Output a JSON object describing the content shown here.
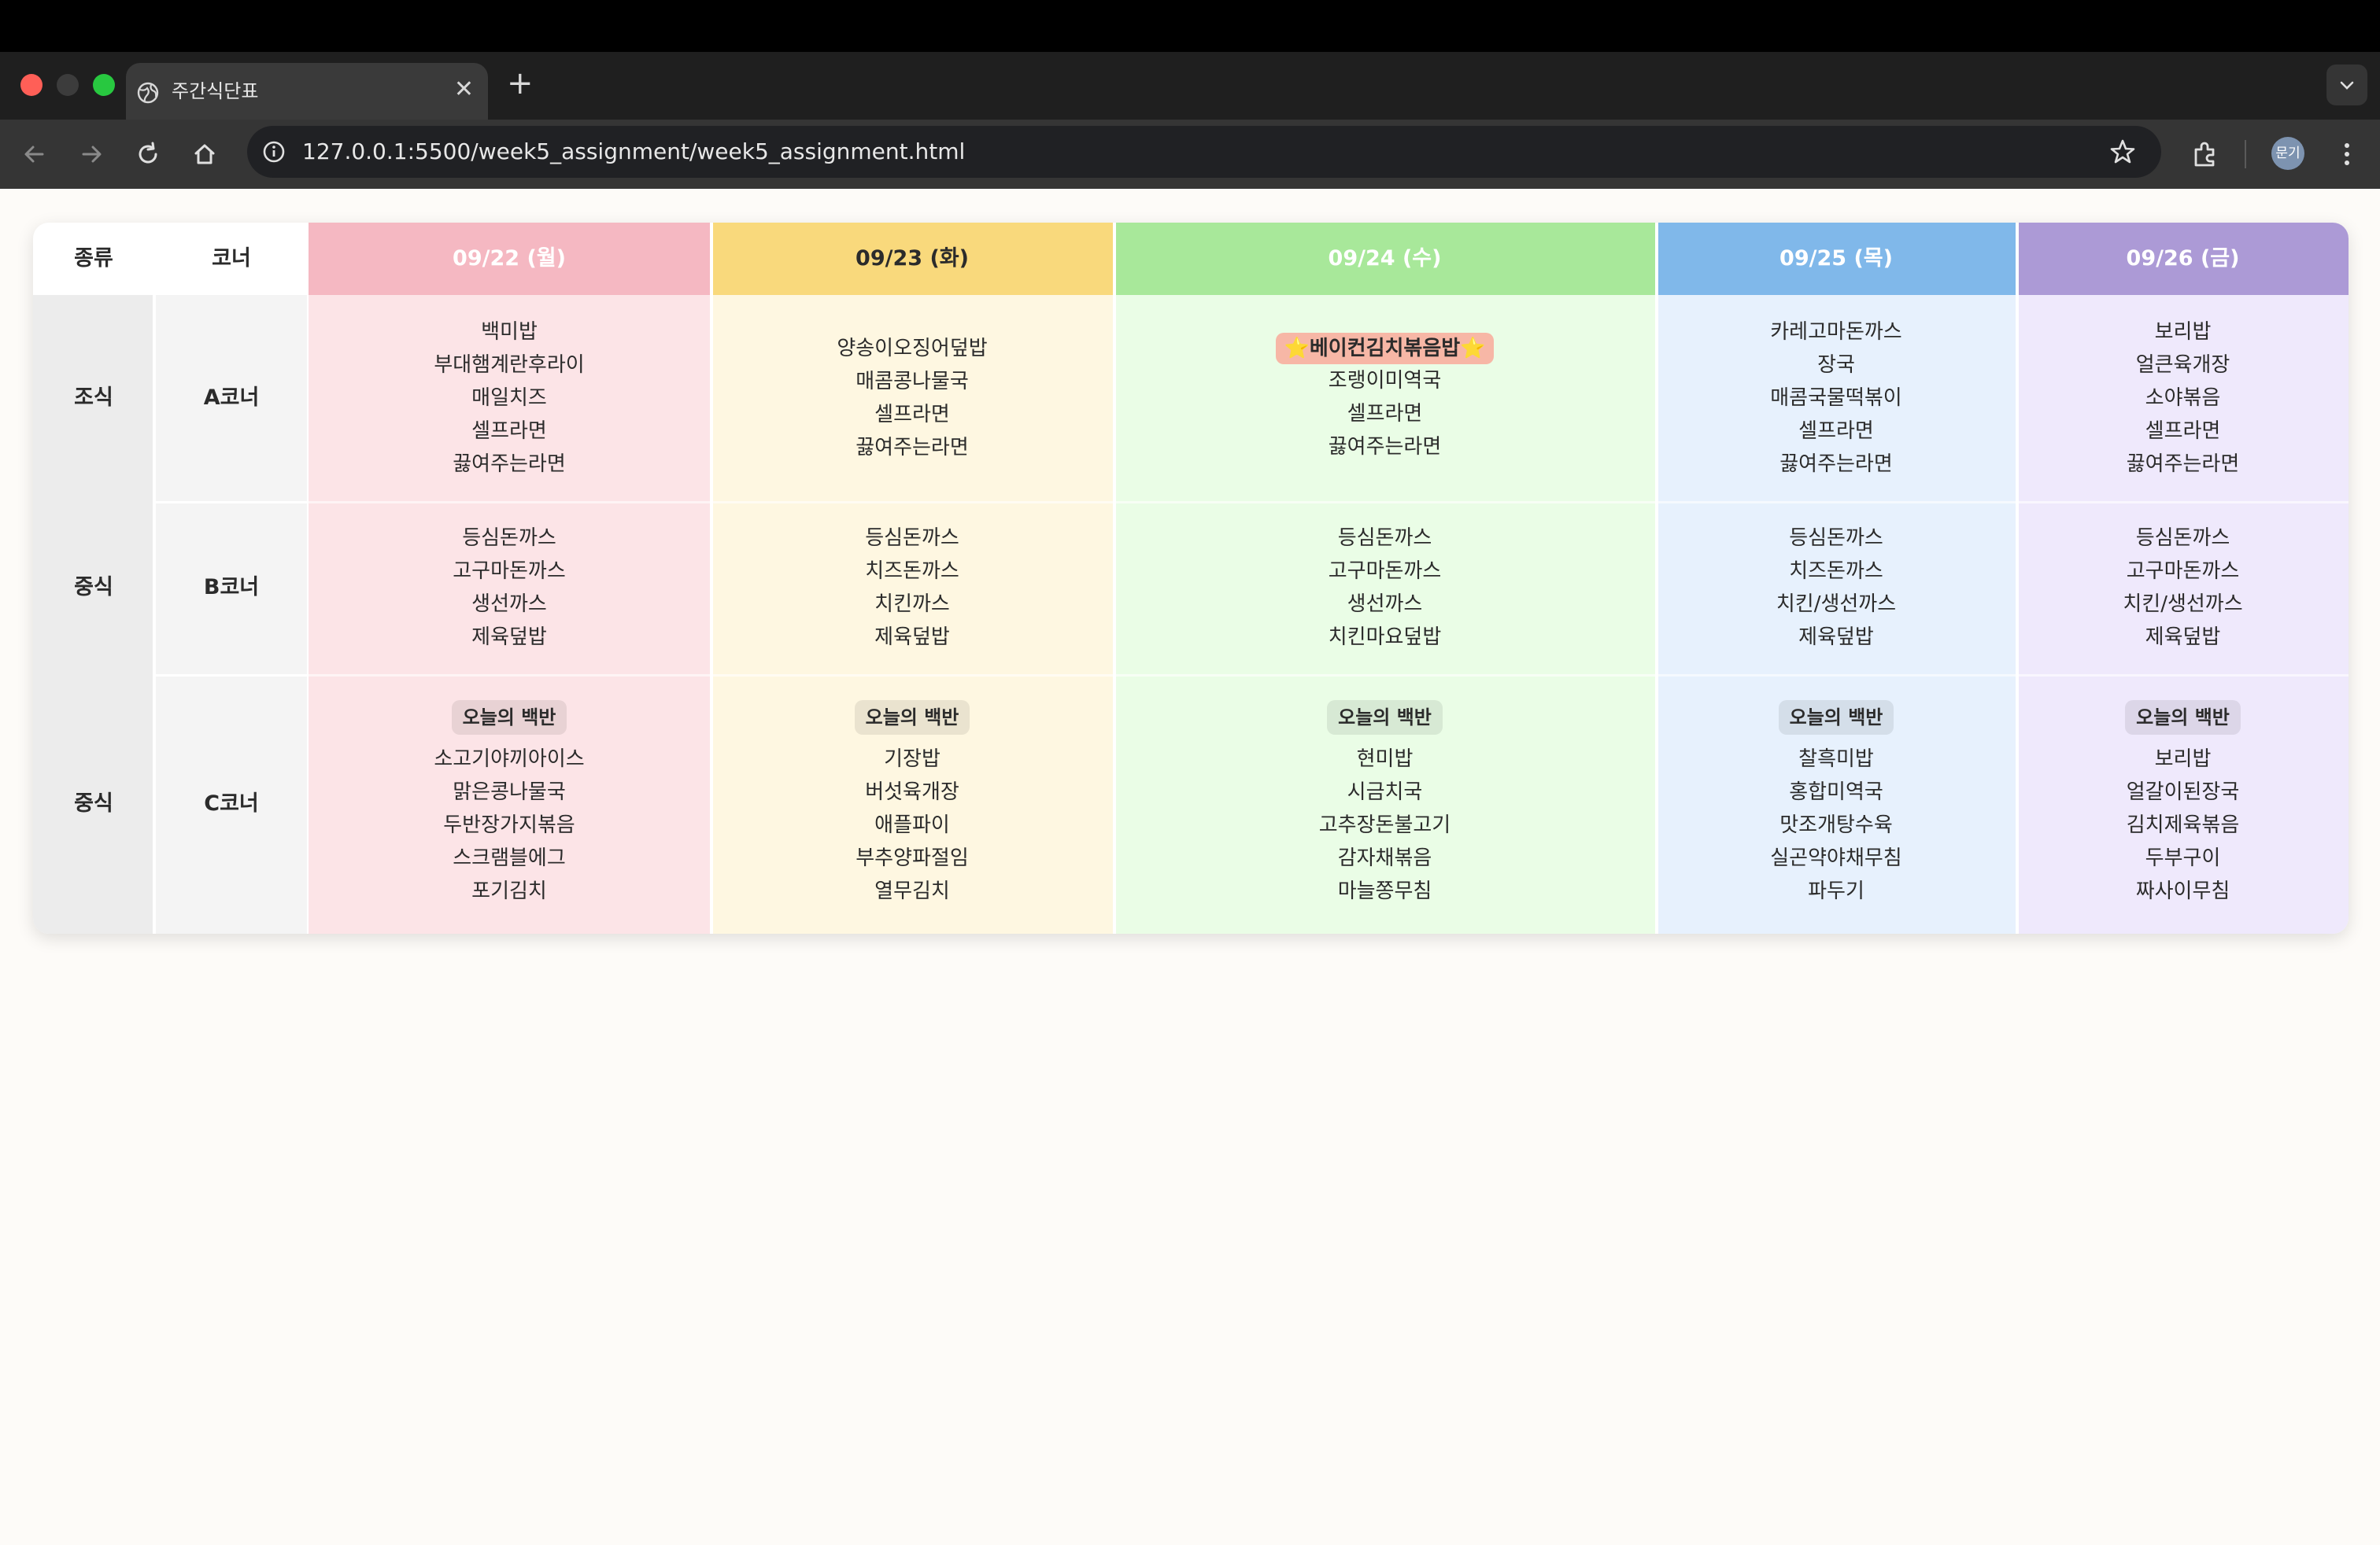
{
  "browser": {
    "tab_title": "주간식단표",
    "url": "127.0.0.1:5500/week5_assignment/week5_assignment.html",
    "profile_label": "문기"
  },
  "table": {
    "header": {
      "type": "종류",
      "corner": "코너"
    },
    "days": [
      {
        "label": "09/22 (월)",
        "header_color": "#f5b8c2",
        "body_color": "#fce4e7",
        "header_text_color": "#ffffff"
      },
      {
        "label": "09/23 (화)",
        "header_color": "#f9d97c",
        "body_color": "#fef7e1",
        "header_text_color": "#2b2b2b"
      },
      {
        "label": "09/24 (수)",
        "header_color": "#a8e89a",
        "body_color": "#eafde6",
        "header_text_color": "#ffffff"
      },
      {
        "label": "09/25 (목)",
        "header_color": "#80b8ea",
        "body_color": "#e7f1fd",
        "header_text_color": "#ffffff"
      },
      {
        "label": "09/26 (금)",
        "header_color": "#ac9ad6",
        "body_color": "#efe9fc",
        "header_text_color": "#ffffff"
      }
    ],
    "rows": [
      {
        "type": "조식",
        "corner": "A코너",
        "menus": [
          [
            "백미밥",
            "부대햄계란후라이",
            "매일치즈",
            "셀프라면",
            "끓여주는라면"
          ],
          [
            "양송이오징어덮밥",
            "매콤콩나물국",
            "셀프라면",
            "끓여주는라면"
          ],
          [
            "조랭이미역국",
            "셀프라면",
            "끓여주는라면"
          ],
          [
            "카레고마돈까스",
            "장국",
            "매콤국물떡볶이",
            "셀프라면",
            "끓여주는라면"
          ],
          [
            "보리밥",
            "얼큰육개장",
            "소야볶음",
            "셀프라면",
            "끓여주는라면"
          ]
        ],
        "special": {
          "day_index": 2,
          "text": "베이컨김치볶음밥",
          "star": "⭐"
        }
      },
      {
        "type": "중식",
        "corner": "B코너",
        "menus": [
          [
            "등심돈까스",
            "고구마돈까스",
            "생선까스",
            "제육덮밥"
          ],
          [
            "등심돈까스",
            "치즈돈까스",
            "치킨까스",
            "제육덮밥"
          ],
          [
            "등심돈까스",
            "고구마돈까스",
            "생선까스",
            "치킨마요덮밥"
          ],
          [
            "등심돈까스",
            "치즈돈까스",
            "치킨/생선까스",
            "제육덮밥"
          ],
          [
            "등심돈까스",
            "고구마돈까스",
            "치킨/생선까스",
            "제육덮밥"
          ]
        ]
      },
      {
        "type": "중식",
        "corner": "C코너",
        "badge": "오늘의 백반",
        "menus": [
          [
            "소고기야끼아이스",
            "맑은콩나물국",
            "두반장가지볶음",
            "스크램블에그",
            "포기김치"
          ],
          [
            "기장밥",
            "버섯육개장",
            "애플파이",
            "부추양파절임",
            "열무김치"
          ],
          [
            "현미밥",
            "시금치국",
            "고추장돈불고기",
            "감자채볶음",
            "마늘쫑무침"
          ],
          [
            "찰흑미밥",
            "홍합미역국",
            "맛조개탕수육",
            "실곤약야채무침",
            "파두기"
          ],
          [
            "보리밥",
            "얼갈이된장국",
            "김치제육볶음",
            "두부구이",
            "짜사이무침"
          ]
        ]
      }
    ]
  }
}
